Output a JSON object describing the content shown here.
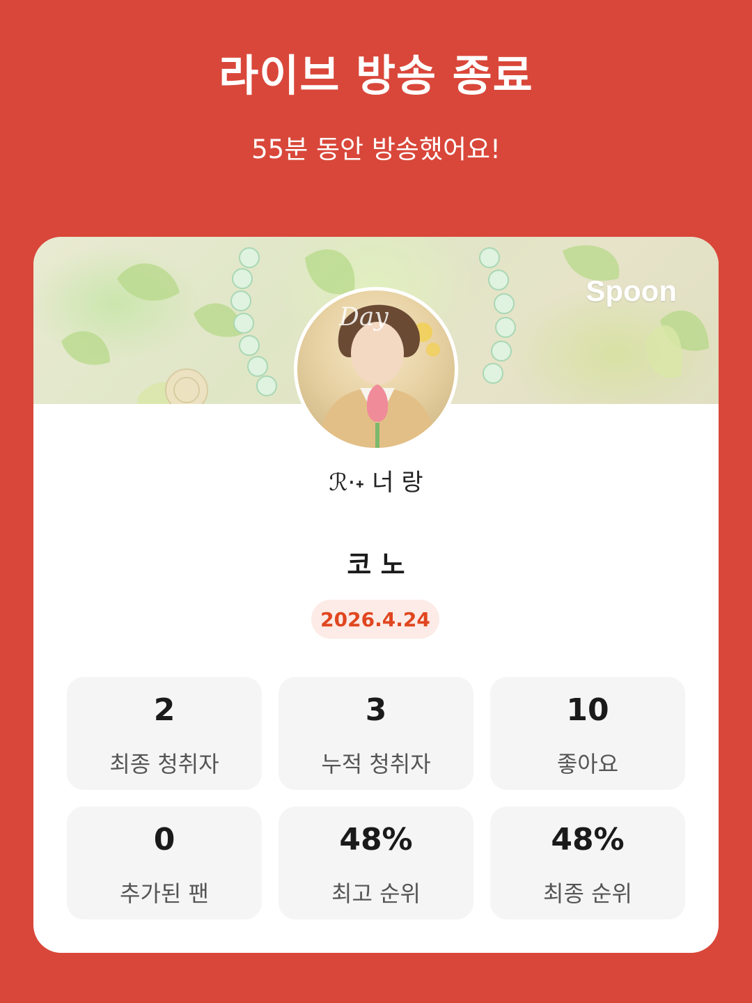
{
  "header": {
    "title": "라이브 방송 종료",
    "subtitle": "55분 동안 방송했어요!"
  },
  "card": {
    "brand_logo": "Spoon",
    "nickname": "ℛ·˖ 너 랑",
    "streamer_name": "코 노",
    "date": "2026.4.24",
    "stats": [
      {
        "value": "2",
        "label": "최종 청취자"
      },
      {
        "value": "3",
        "label": "누적 청취자"
      },
      {
        "value": "10",
        "label": "좋아요"
      },
      {
        "value": "0",
        "label": "추가된 팬"
      },
      {
        "value": "48%",
        "label": "최고 순위"
      },
      {
        "value": "48%",
        "label": "최종 순위"
      }
    ]
  },
  "colors": {
    "background": "#d9473a",
    "card": "#ffffff",
    "date_badge_bg": "#fcebe6",
    "date_badge_text": "#e0461f",
    "stat_tile": "#f5f5f5"
  }
}
